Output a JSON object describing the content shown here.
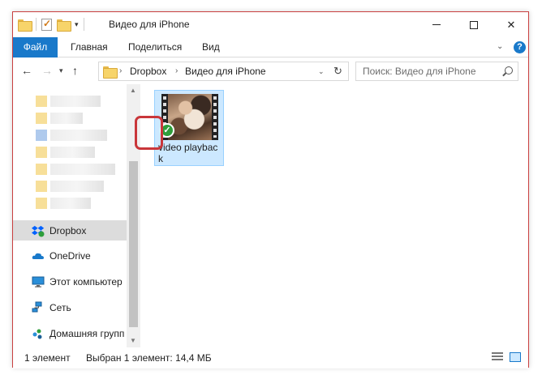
{
  "window": {
    "title": "Видео для iPhone",
    "controls": {
      "minimize": "—",
      "maximize": "☐",
      "close": "✕"
    }
  },
  "ribbon": {
    "tabs": [
      "Файл",
      "Главная",
      "Поделиться",
      "Вид"
    ],
    "help": "?"
  },
  "address": {
    "crumbs": [
      "Dropbox",
      "Видео для iPhone"
    ],
    "separator": "›",
    "refresh_icon": "↻"
  },
  "search": {
    "placeholder": "Поиск: Видео для iPhone"
  },
  "nav": {
    "items": [
      {
        "label": "Dropbox",
        "icon": "dropbox-icon",
        "selected": true
      },
      {
        "label": "OneDrive",
        "icon": "onedrive-icon",
        "selected": false
      },
      {
        "label": "Этот компьютер",
        "icon": "computer-icon",
        "selected": false
      },
      {
        "label": "Сеть",
        "icon": "network-icon",
        "selected": false
      },
      {
        "label": "Домашняя групп",
        "icon": "homegroup-icon",
        "selected": false
      }
    ]
  },
  "files": [
    {
      "name": "video playback",
      "icon": "video-file-icon",
      "status": "synced"
    }
  ],
  "status": {
    "count": "1 элемент",
    "selection": "Выбран 1 элемент: 14,4 МБ"
  },
  "colors": {
    "accent": "#1979ca",
    "selection": "#cce8ff",
    "highlight": "#c9363a",
    "sync_ok": "#2f9e3b"
  }
}
